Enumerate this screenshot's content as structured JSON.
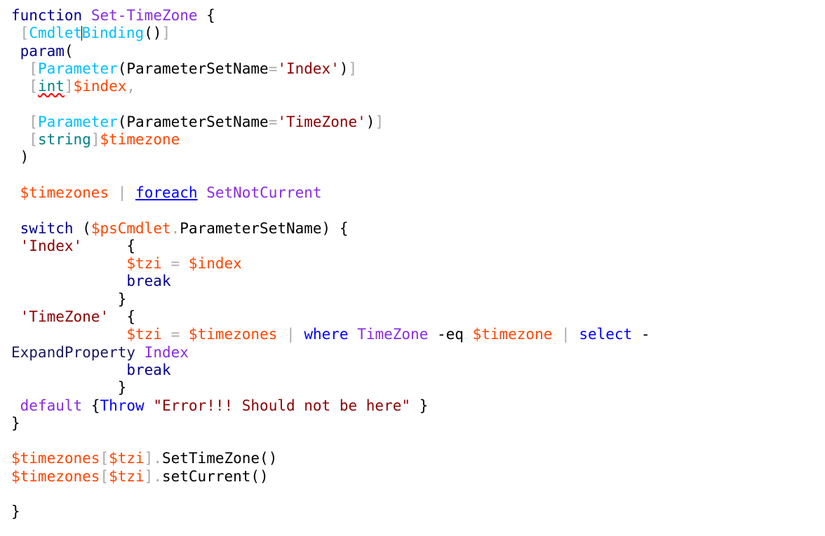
{
  "app": {
    "name": "powershell-script-editor",
    "background_color": "#ffffff",
    "font_size_px": 21,
    "line_height_px": 25.3
  },
  "theme": {
    "keyword": "#00008b",
    "command": "#0000ff",
    "function_name": "#8a2be2",
    "attribute": "#00bfff",
    "type": "#008080",
    "variable": "#ff4500",
    "string": "#8b0000",
    "operator": "#a9a9a9",
    "plain": "#000000",
    "error_squiggle": "#ff0000",
    "caret": "#000000"
  },
  "editor": {
    "caret_line": 2,
    "caret_after_text": "Cmdlet",
    "lines": [
      {
        "n": 1,
        "text": "function Set-TimeZone {",
        "tokens": [
          {
            "t": "function",
            "k": "keyword"
          },
          {
            "t": " ",
            "k": "plain"
          },
          {
            "t": "Set-TimeZone",
            "k": "function_name"
          },
          {
            "t": " {",
            "k": "plain"
          }
        ]
      },
      {
        "n": 2,
        "text": " [CmdletBinding()]",
        "tokens": [
          {
            "t": " ",
            "k": "plain"
          },
          {
            "t": "[",
            "k": "operator"
          },
          {
            "t": "Cmdlet",
            "k": "attribute"
          },
          {
            "t": "CARET",
            "k": "caret"
          },
          {
            "t": "Binding",
            "k": "attribute"
          },
          {
            "t": "()",
            "k": "plain"
          },
          {
            "t": "]",
            "k": "operator"
          }
        ]
      },
      {
        "n": 3,
        "text": " param(",
        "tokens": [
          {
            "t": " ",
            "k": "plain"
          },
          {
            "t": "param",
            "k": "keyword"
          },
          {
            "t": "(",
            "k": "plain"
          }
        ]
      },
      {
        "n": 4,
        "text": "  [Parameter(ParameterSetName='Index')]",
        "tokens": [
          {
            "t": "  ",
            "k": "plain"
          },
          {
            "t": "[",
            "k": "operator"
          },
          {
            "t": "Parameter",
            "k": "attribute"
          },
          {
            "t": "(ParameterSetName",
            "k": "plain"
          },
          {
            "t": "=",
            "k": "operator"
          },
          {
            "t": "'Index'",
            "k": "string"
          },
          {
            "t": ")",
            "k": "plain"
          },
          {
            "t": "]",
            "k": "operator"
          }
        ]
      },
      {
        "n": 5,
        "text": "  [int]$index,",
        "tokens": [
          {
            "t": "  ",
            "k": "plain"
          },
          {
            "t": "[",
            "k": "operator"
          },
          {
            "t": "int",
            "k": "type_error"
          },
          {
            "t": "]",
            "k": "operator"
          },
          {
            "t": "$index",
            "k": "variable"
          },
          {
            "t": ",",
            "k": "operator"
          }
        ]
      },
      {
        "n": 6,
        "text": "",
        "tokens": []
      },
      {
        "n": 7,
        "text": "  [Parameter(ParameterSetName='TimeZone')]",
        "tokens": [
          {
            "t": "  ",
            "k": "plain"
          },
          {
            "t": "[",
            "k": "operator"
          },
          {
            "t": "Parameter",
            "k": "attribute"
          },
          {
            "t": "(ParameterSetName",
            "k": "plain"
          },
          {
            "t": "=",
            "k": "operator"
          },
          {
            "t": "'TimeZone'",
            "k": "string"
          },
          {
            "t": ")",
            "k": "plain"
          },
          {
            "t": "]",
            "k": "operator"
          }
        ]
      },
      {
        "n": 8,
        "text": "  [string]$timezone",
        "tokens": [
          {
            "t": "  ",
            "k": "plain"
          },
          {
            "t": "[",
            "k": "operator"
          },
          {
            "t": "string",
            "k": "type"
          },
          {
            "t": "]",
            "k": "operator"
          },
          {
            "t": "$timezone",
            "k": "variable"
          }
        ]
      },
      {
        "n": 9,
        "text": " )",
        "tokens": [
          {
            "t": " )",
            "k": "plain"
          }
        ]
      },
      {
        "n": 10,
        "text": "",
        "tokens": []
      },
      {
        "n": 11,
        "text": " $timezones | foreach SetNotCurrent",
        "tokens": [
          {
            "t": " ",
            "k": "plain"
          },
          {
            "t": "$timezones",
            "k": "variable"
          },
          {
            "t": " ",
            "k": "plain"
          },
          {
            "t": "|",
            "k": "operator"
          },
          {
            "t": " ",
            "k": "plain"
          },
          {
            "t": "foreach",
            "k": "command_error"
          },
          {
            "t": " ",
            "k": "plain"
          },
          {
            "t": "SetNotCurrent",
            "k": "function_name"
          }
        ]
      },
      {
        "n": 12,
        "text": "",
        "tokens": []
      },
      {
        "n": 13,
        "text": " switch ($psCmdlet.ParameterSetName) {",
        "tokens": [
          {
            "t": " ",
            "k": "plain"
          },
          {
            "t": "switch",
            "k": "keyword"
          },
          {
            "t": " (",
            "k": "plain"
          },
          {
            "t": "$psCmdlet",
            "k": "variable"
          },
          {
            "t": ".",
            "k": "operator"
          },
          {
            "t": "ParameterSetName) {",
            "k": "plain"
          }
        ]
      },
      {
        "n": 14,
        "text": " 'Index'     {",
        "tokens": [
          {
            "t": " ",
            "k": "plain"
          },
          {
            "t": "'Index'",
            "k": "string"
          },
          {
            "t": "     {",
            "k": "plain"
          }
        ]
      },
      {
        "n": 15,
        "text": "             $tzi = $index",
        "tokens": [
          {
            "t": "             ",
            "k": "plain"
          },
          {
            "t": "$tzi",
            "k": "variable"
          },
          {
            "t": " ",
            "k": "plain"
          },
          {
            "t": "=",
            "k": "operator"
          },
          {
            "t": " ",
            "k": "plain"
          },
          {
            "t": "$index",
            "k": "variable"
          }
        ]
      },
      {
        "n": 16,
        "text": "             break",
        "tokens": [
          {
            "t": "             ",
            "k": "plain"
          },
          {
            "t": "break",
            "k": "keyword"
          }
        ]
      },
      {
        "n": 17,
        "text": "            }",
        "tokens": [
          {
            "t": "            }",
            "k": "plain"
          }
        ]
      },
      {
        "n": 18,
        "text": " 'TimeZone'  {",
        "tokens": [
          {
            "t": " ",
            "k": "plain"
          },
          {
            "t": "'TimeZone'",
            "k": "string"
          },
          {
            "t": "  {",
            "k": "plain"
          }
        ]
      },
      {
        "n": 19,
        "text": "             $tzi = $timezones | where TimeZone -eq $timezone | select -ExpandProperty Index",
        "wrapped": true,
        "tokens": [
          {
            "t": "             ",
            "k": "plain"
          },
          {
            "t": "$tzi",
            "k": "variable"
          },
          {
            "t": " ",
            "k": "plain"
          },
          {
            "t": "=",
            "k": "operator"
          },
          {
            "t": " ",
            "k": "plain"
          },
          {
            "t": "$timezones",
            "k": "variable"
          },
          {
            "t": " ",
            "k": "plain"
          },
          {
            "t": "|",
            "k": "operator"
          },
          {
            "t": " ",
            "k": "plain"
          },
          {
            "t": "where",
            "k": "command"
          },
          {
            "t": " ",
            "k": "plain"
          },
          {
            "t": "TimeZone",
            "k": "function_name"
          },
          {
            "t": " -eq ",
            "k": "plain"
          },
          {
            "t": "$timezone",
            "k": "variable"
          },
          {
            "t": " ",
            "k": "plain"
          },
          {
            "t": "|",
            "k": "operator"
          },
          {
            "t": " ",
            "k": "plain"
          },
          {
            "t": "select",
            "k": "command"
          },
          {
            "t": " -",
            "k": "plain"
          }
        ]
      },
      {
        "n": "19b",
        "text": "ExpandProperty Index",
        "continuation": true,
        "tokens": [
          {
            "t": "ExpandProperty",
            "k": "dark"
          },
          {
            "t": " ",
            "k": "plain"
          },
          {
            "t": "Index",
            "k": "function_name"
          }
        ]
      },
      {
        "n": 20,
        "text": "             break",
        "tokens": [
          {
            "t": "             ",
            "k": "plain"
          },
          {
            "t": "break",
            "k": "keyword"
          }
        ]
      },
      {
        "n": 21,
        "text": "            }",
        "tokens": [
          {
            "t": "            }",
            "k": "plain"
          }
        ]
      },
      {
        "n": 22,
        "text": " default {Throw \"Error!!! Should not be here\" }",
        "tokens": [
          {
            "t": " ",
            "k": "plain"
          },
          {
            "t": "default",
            "k": "function_name"
          },
          {
            "t": " {",
            "k": "plain"
          },
          {
            "t": "Throw",
            "k": "command"
          },
          {
            "t": " ",
            "k": "plain"
          },
          {
            "t": "\"Error!!! Should not be here\"",
            "k": "string"
          },
          {
            "t": " }",
            "k": "plain"
          }
        ]
      },
      {
        "n": 23,
        "text": "}",
        "tokens": [
          {
            "t": "}",
            "k": "plain"
          }
        ]
      },
      {
        "n": 24,
        "text": "",
        "tokens": []
      },
      {
        "n": 25,
        "text": "$timezones[$tzi].SetTimeZone()",
        "tokens": [
          {
            "t": "$timezones",
            "k": "variable"
          },
          {
            "t": "[",
            "k": "operator"
          },
          {
            "t": "$tzi",
            "k": "variable"
          },
          {
            "t": "]",
            "k": "operator"
          },
          {
            "t": ".",
            "k": "operator"
          },
          {
            "t": "SetTimeZone()",
            "k": "plain"
          }
        ]
      },
      {
        "n": 26,
        "text": "$timezones[$tzi].setCurrent()",
        "tokens": [
          {
            "t": "$timezones",
            "k": "variable"
          },
          {
            "t": "[",
            "k": "operator"
          },
          {
            "t": "$tzi",
            "k": "variable"
          },
          {
            "t": "]",
            "k": "operator"
          },
          {
            "t": ".",
            "k": "operator"
          },
          {
            "t": "setCurrent()",
            "k": "plain"
          }
        ]
      },
      {
        "n": 27,
        "text": "",
        "tokens": []
      },
      {
        "n": 28,
        "text": "}",
        "tokens": [
          {
            "t": "}",
            "k": "plain"
          }
        ]
      }
    ]
  }
}
